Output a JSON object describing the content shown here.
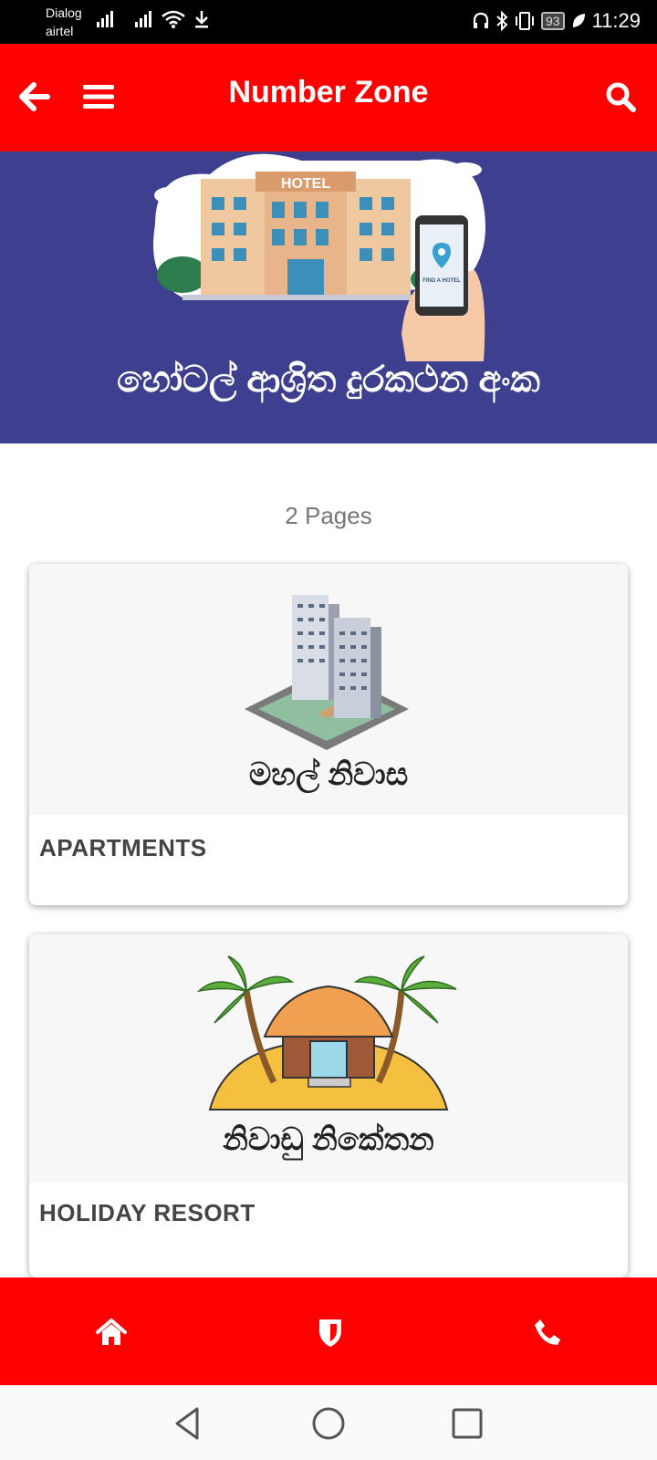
{
  "status": {
    "carrier1": "Dialog",
    "carrier2": "airtel",
    "battery": "93",
    "time": "11:29"
  },
  "appbar": {
    "title": "Number Zone"
  },
  "banner": {
    "building_sign": "HOTEL",
    "phone_label": "FIND A HOTEL",
    "caption": "හෝටල් ආශ්‍රිත දුරකථන අංක"
  },
  "pages_count": "2 Pages",
  "cards": [
    {
      "sub_title": "මහල් නිවාස",
      "label": "APARTMENTS"
    },
    {
      "sub_title": "නිවාඩු නිකේතන",
      "label": "HOLIDAY RESORT"
    }
  ],
  "colors": {
    "primary": "#ff0000",
    "banner_bg": "#3f3f8f"
  },
  "icons": {
    "back": "arrow-left-icon",
    "menu": "hamburger-menu-icon",
    "search": "search-icon",
    "home": "home-icon",
    "shield": "shield-icon",
    "phone": "phone-icon"
  }
}
